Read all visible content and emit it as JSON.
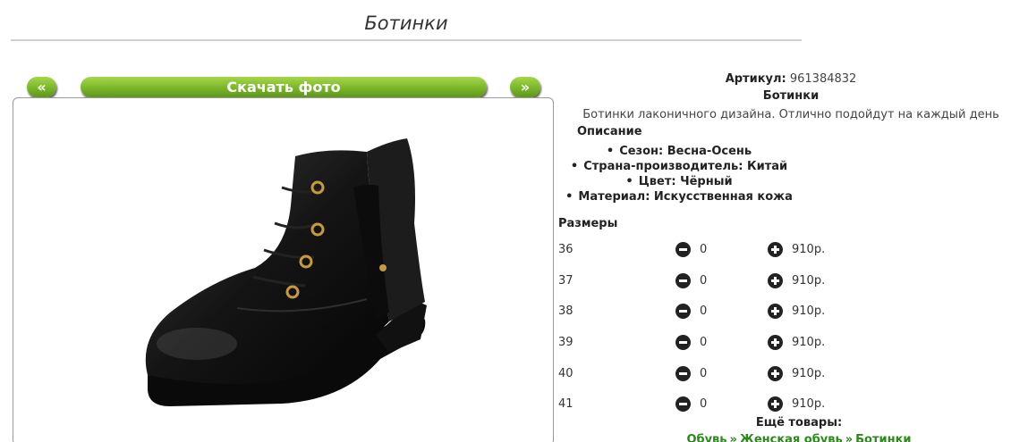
{
  "page": {
    "title": "Ботинки"
  },
  "nav": {
    "prev_label": "«",
    "next_label": "»",
    "download_label": "Скачать фото"
  },
  "product": {
    "article_label": "Артикул:",
    "article_value": "961384832",
    "name": "Ботинки",
    "short_description": "Ботинки лаконичного дизайна. Отлично подойдут на каждый день",
    "description_heading": "Описание",
    "properties": [
      "Сезон: Весна-Осень",
      "Страна-производитель: Китай",
      "Цвет: Чёрный",
      "Материал: Искусственная кожа"
    ]
  },
  "sizes": {
    "heading": "Размеры",
    "rows": [
      {
        "size": "36",
        "qty": "0",
        "price": "910р."
      },
      {
        "size": "37",
        "qty": "0",
        "price": "910р."
      },
      {
        "size": "38",
        "qty": "0",
        "price": "910р."
      },
      {
        "size": "39",
        "qty": "0",
        "price": "910р."
      },
      {
        "size": "40",
        "qty": "0",
        "price": "910р."
      },
      {
        "size": "41",
        "qty": "0",
        "price": "910р."
      }
    ]
  },
  "more": {
    "label": "Ещё товары:",
    "breadcrumbs": [
      "Обувь",
      "Женская обувь",
      "Ботинки"
    ],
    "separator": "»"
  },
  "colors": {
    "button_green": "#7ab52a",
    "link_green": "#2a8a1a"
  }
}
